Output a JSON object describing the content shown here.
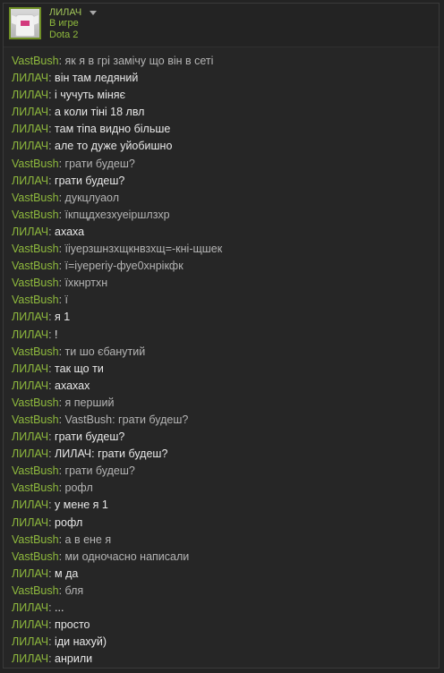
{
  "header": {
    "username": "ЛИЛАЧ",
    "status": "В игре",
    "game": "Dota 2"
  },
  "messages": [
    {
      "nick": "VastBush",
      "text": "як я в грі замічу що він в сеті"
    },
    {
      "nick": "ЛИЛАЧ",
      "text": "він там ледяний"
    },
    {
      "nick": "ЛИЛАЧ",
      "text": "і чучуть міняє"
    },
    {
      "nick": "ЛИЛАЧ",
      "text": "а коли тіні 18 лвл"
    },
    {
      "nick": "ЛИЛАЧ",
      "text": "там тіпа видно більше"
    },
    {
      "nick": "ЛИЛАЧ",
      "text": "але то дуже уйобишно"
    },
    {
      "nick": "VastBush",
      "text": "грати будеш?"
    },
    {
      "nick": "ЛИЛАЧ",
      "text": "грати будеш?"
    },
    {
      "nick": "VastBush",
      "text": "дукцлуаол"
    },
    {
      "nick": "VastBush",
      "text": "їкпщдхезхуеіршлзхр"
    },
    {
      "nick": "ЛИЛАЧ",
      "text": "ахаха"
    },
    {
      "nick": "VastBush",
      "text": "їіуерзшнзхщкнвзхщ=-кні-щшек"
    },
    {
      "nick": "VastBush",
      "text": "ї=іуеperіу-фуе0хнрікфк"
    },
    {
      "nick": "VastBush",
      "text": "їхкнртхн"
    },
    {
      "nick": "VastBush",
      "text": "ї"
    },
    {
      "nick": "ЛИЛАЧ",
      "text": "я 1"
    },
    {
      "nick": "ЛИЛАЧ",
      "text": "!"
    },
    {
      "nick": "VastBush",
      "text": "ти шо єбанутий"
    },
    {
      "nick": "ЛИЛАЧ",
      "text": "так що ти"
    },
    {
      "nick": "ЛИЛАЧ",
      "text": "ахахах"
    },
    {
      "nick": "VastBush",
      "text": "я перший"
    },
    {
      "nick": "VastBush",
      "text": "VastBush: грати будеш?"
    },
    {
      "nick": "ЛИЛАЧ",
      "text": "грати будеш?"
    },
    {
      "nick": "ЛИЛАЧ",
      "text": "ЛИЛАЧ: грати будеш?"
    },
    {
      "nick": "VastBush",
      "text": "грати будеш?"
    },
    {
      "nick": "VastBush",
      "text": "рофл"
    },
    {
      "nick": "ЛИЛАЧ",
      "text": "у мене я 1"
    },
    {
      "nick": "ЛИЛАЧ",
      "text": "рофл"
    },
    {
      "nick": "VastBush",
      "text": "а в ене я"
    },
    {
      "nick": "VastBush",
      "text": "ми одночасно написали"
    },
    {
      "nick": "ЛИЛАЧ",
      "text": "м да"
    },
    {
      "nick": "VastBush",
      "text": "бля"
    },
    {
      "nick": "ЛИЛАЧ",
      "text": "..."
    },
    {
      "nick": "ЛИЛАЧ",
      "text": "просто"
    },
    {
      "nick": "ЛИЛАЧ",
      "text": "іди нахуй)"
    },
    {
      "nick": "ЛИЛАЧ",
      "text": "анрили"
    }
  ],
  "colors": {
    "nick": "#8fba3d",
    "background": "#262626",
    "accent_border": "#6f8f26"
  },
  "icons": {
    "dropdown": "chevron-down-icon"
  }
}
